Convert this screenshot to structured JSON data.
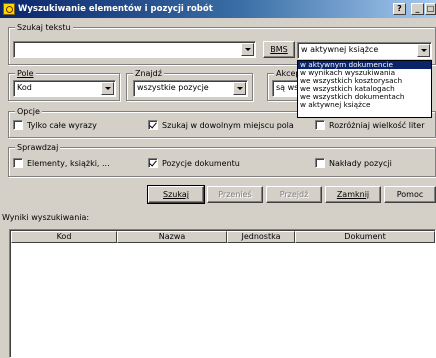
{
  "window": {
    "title": "Wyszukiwanie elementów i pozycji robót",
    "help": "?",
    "minimize": "_",
    "maximize": "□"
  },
  "search_text": {
    "group_label": "Szukaj tekstu",
    "value": "",
    "bms_label": "BMS",
    "scope_value": "w aktywnej książce"
  },
  "scope_options": [
    "w aktywnym dokumencie",
    "w wynikach wyszukiwania",
    "we wszystkich kosztorysach",
    "we wszystkich katalogach",
    "we wszystkich dokumentach",
    "w aktywnej książce"
  ],
  "field": {
    "group_label": "Pole",
    "value": "Kod"
  },
  "find": {
    "group_label": "Znajdź",
    "value": "wszystkie pozycje"
  },
  "accept": {
    "group_label": "Akcep",
    "value": "są ws"
  },
  "options": {
    "group_label": "Opcje",
    "whole_words": "Tylko całe wyrazy",
    "anywhere": "Szukaj w dowolnym miejscu pola",
    "case_sensitive": "Rozróżniaj wielkość liter"
  },
  "check": {
    "group_label": "Sprawdzaj",
    "elements": "Elementy, książki, ...",
    "positions": "Pozycje dokumentu",
    "expenditures": "Nakłady pozycji"
  },
  "buttons": {
    "search": "Szukaj",
    "move": "Przenieś",
    "jump": "Przejdź",
    "close": "Zamknij",
    "help": "Pomoc"
  },
  "results": {
    "label": "Wyniki wyszukiwania:",
    "columns": [
      "Kod",
      "Nazwa",
      "Jednostka",
      "Dokument"
    ]
  },
  "colors": {
    "titlebar": "#0a246a",
    "face": "#d4d0c8",
    "selection": "#0a246a"
  }
}
